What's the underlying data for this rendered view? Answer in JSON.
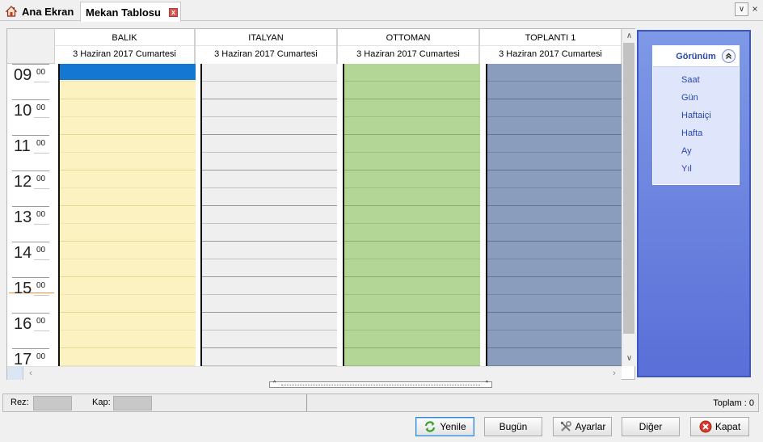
{
  "tabs": [
    {
      "label": "Ana Ekran"
    },
    {
      "label": "Mekan Tablosu",
      "close_glyph": "x"
    }
  ],
  "tabbar": {
    "menu_glyph": "∨",
    "close_glyph": "×"
  },
  "scheduler": {
    "resources": [
      {
        "name": "BALIK",
        "date": "3 Haziran 2017 Cumartesi",
        "color": "#fcf1c0",
        "line": "#e6d894"
      },
      {
        "name": "ITALYAN",
        "date": "3 Haziran 2017 Cumartesi",
        "color": "#efefef",
        "line": "#9a9a9a"
      },
      {
        "name": "OTTOMAN",
        "date": "3 Haziran 2017 Cumartesi",
        "color": "#b3d596",
        "line": "#8ab168"
      },
      {
        "name": "TOPLANTI 1",
        "date": "3 Haziran 2017 Cumartesi",
        "color": "#8a9dbd",
        "line": "#5f7398"
      }
    ],
    "hours": [
      {
        "h": "09",
        "m": "00"
      },
      {
        "h": "10",
        "m": "00"
      },
      {
        "h": "11",
        "m": "00"
      },
      {
        "h": "12",
        "m": "00"
      },
      {
        "h": "13",
        "m": "00"
      },
      {
        "h": "14",
        "m": "00"
      },
      {
        "h": "15",
        "m": "00"
      },
      {
        "h": "16",
        "m": "00"
      },
      {
        "h": "17",
        "m": "00"
      }
    ],
    "selection_color": "#1478d3",
    "current_time_color": "#f28a36"
  },
  "view_panel": {
    "title": "Görünüm",
    "collapse_glyph": "⌃",
    "items": [
      "Saat",
      "Gün",
      "Haftaiçi",
      "Hafta",
      "Ay",
      "Yıl"
    ]
  },
  "status": {
    "rez_label": "Rez:",
    "kap_label": "Kap:",
    "total": "Toplam : 0"
  },
  "buttons": {
    "refresh": "Yenile",
    "today": "Bugün",
    "settings": "Ayarlar",
    "other": "Diğer",
    "close": "Kapat"
  }
}
